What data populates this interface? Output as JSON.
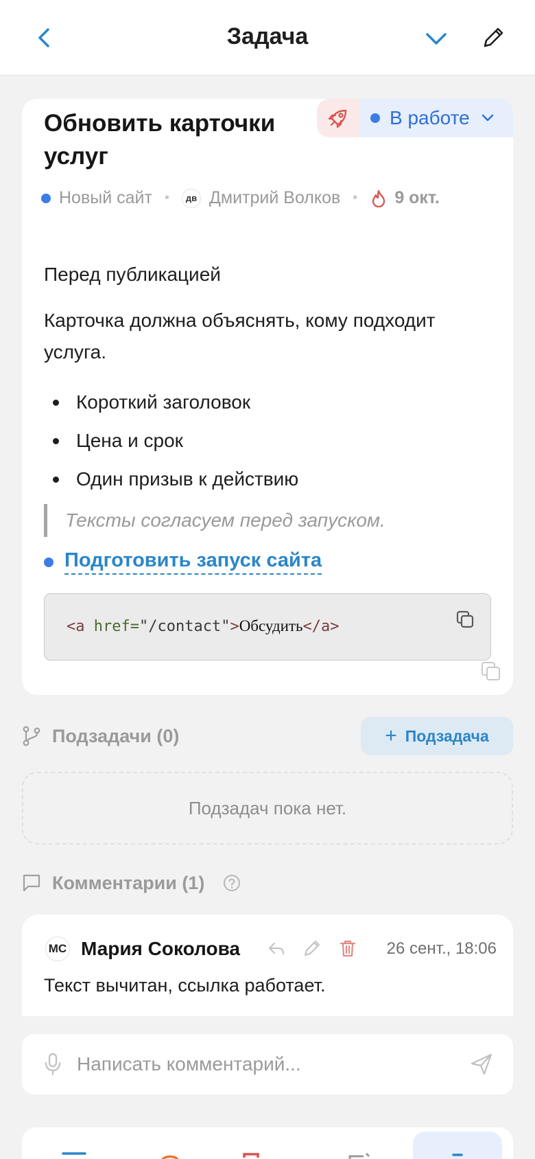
{
  "header": {
    "title": "Задача",
    "back_icon": "chevron-left-icon",
    "collapse_icon": "chevron-down-icon",
    "edit_icon": "pencil-icon"
  },
  "task": {
    "title": "Обновить карточки услуг",
    "status": "В работе",
    "status_color": "#3b7de8",
    "priority_icon": "rocket-icon",
    "project": "Новый сайт",
    "assignee_initials": "дв",
    "assignee": "Дмитрий Волков",
    "due": "9 окт.",
    "description": {
      "heading": "Перед публикацией",
      "paragraph": "Карточка должна объяснять, кому подходит услуга.",
      "bullets": [
        "Короткий заголовок",
        "Цена и срок",
        "Один призыв к действию"
      ],
      "quote": "Тексты согласуем перед запуском.",
      "linked_task": "Подготовить запуск сайта",
      "code": {
        "open_tag": "<a",
        "attr": "href=",
        "value": "\"/contact\"",
        "close_open": ">",
        "text": "Обсудить",
        "end_tag": "</a>"
      }
    }
  },
  "subtasks": {
    "label": "Подзадачи (0)",
    "add_label": "Подзадача",
    "empty_text": "Подзадач пока нет."
  },
  "comments": {
    "label": "Комментарии (1)",
    "items": [
      {
        "initials": "МС",
        "author": "Мария Соколова",
        "time": "26 сент., 18:06",
        "text": "Текст вычитан, ссылка работает."
      }
    ],
    "composer_placeholder": "Написать комментарий..."
  },
  "colors": {
    "accent": "#2a86c8",
    "danger": "#d9534f",
    "background": "#f2f2f3"
  }
}
